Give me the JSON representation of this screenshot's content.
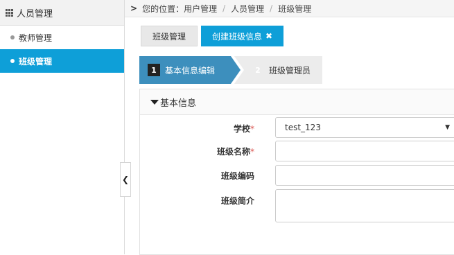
{
  "sidebar": {
    "header": "人员管理",
    "items": [
      {
        "label": "教师管理"
      },
      {
        "label": "班级管理"
      }
    ]
  },
  "breadcrumb": {
    "prefix": "您的位置：",
    "items": [
      "用户管理",
      "人员管理",
      "班级管理"
    ]
  },
  "tabs": [
    {
      "label": "班级管理"
    },
    {
      "label": "创建班级信息",
      "close": "✖"
    }
  ],
  "steps": [
    {
      "num": "1",
      "label": "基本信息编辑"
    },
    {
      "num": "2",
      "label": "班级管理员"
    }
  ],
  "panel": {
    "title": "基本信息",
    "fields": {
      "school": {
        "label": "学校",
        "required": "*",
        "value": "test_123"
      },
      "class_name": {
        "label": "班级名称",
        "required": "*",
        "value": ""
      },
      "class_code": {
        "label": "班级编码",
        "value": ""
      },
      "class_intro": {
        "label": "班级简介",
        "value": ""
      }
    }
  },
  "colors": {
    "accent": "#0e9fd8",
    "step_active": "#3d8fbd",
    "required": "#d9534f"
  }
}
